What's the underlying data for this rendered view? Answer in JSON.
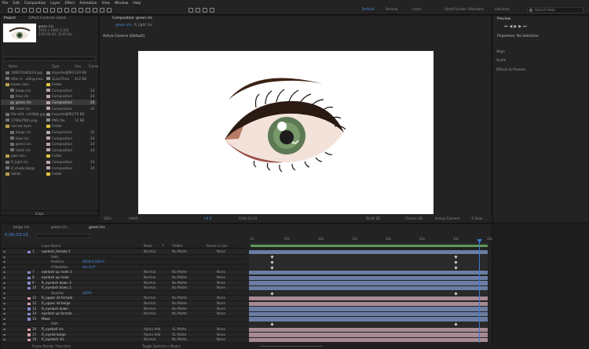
{
  "menu": [
    "File",
    "Edit",
    "Composition",
    "Layer",
    "Effect",
    "Animation",
    "View",
    "Window",
    "Help"
  ],
  "workspaces": [
    {
      "label": "Default",
      "active": true
    },
    {
      "label": "Review",
      "active": false
    },
    {
      "label": "Learn",
      "active": false
    },
    {
      "label": "Small Screen",
      "active": false
    },
    {
      "label": "Standard",
      "active": false
    },
    {
      "label": "Libraries",
      "active": false
    }
  ],
  "search_placeholder": "Search Help",
  "project": {
    "tab_project": "Project",
    "tab_effect": "Effect Controls: blank",
    "thumb_info": [
      "green iris",
      "1920 x 1080 (1.00)",
      "0:00:00:00, 24.00 fps"
    ],
    "columns": {
      "name": "Name",
      "type": "Type",
      "size": "Size",
      "frame": "Frame"
    },
    "items": [
      {
        "name": "1066703b5b19.jpg",
        "type": "ImportedJPEG",
        "size": "129 KB",
        "frame": "",
        "color": "#8a8a8a",
        "indent": 0,
        "sel": false
      },
      {
        "name": "Alter Ic...ading.mov",
        "type": "QuickTime",
        "size": "412 KB",
        "frame": "",
        "color": "#8a8a8a",
        "indent": 0,
        "sel": false
      },
      {
        "name": "brown skin",
        "type": "Folder",
        "size": "",
        "frame": "",
        "color": "#e0c040",
        "indent": 0,
        "sel": false
      },
      {
        "name": "beige iris",
        "type": "Composition",
        "size": "",
        "frame": "24",
        "color": "#b9a6a8",
        "indent": 1,
        "sel": false
      },
      {
        "name": "blue iris",
        "type": "Composition",
        "size": "",
        "frame": "24",
        "color": "#b9a6a8",
        "indent": 1,
        "sel": false
      },
      {
        "name": "green iris",
        "type": "Composition",
        "size": "",
        "frame": "24",
        "color": "#b9a6a8",
        "indent": 1,
        "sel": true
      },
      {
        "name": "hazel iris",
        "type": "Composition",
        "size": "",
        "frame": "24",
        "color": "#b9a6a8",
        "indent": 1,
        "sel": false
      },
      {
        "name": "file-ref4...ktzi0bb.jpg",
        "type": "ImportedJPEG",
        "size": "70 KB",
        "frame": "",
        "color": "#8a8a8a",
        "indent": 0,
        "sel": false
      },
      {
        "name": "1760a790h.png",
        "type": "PNG file",
        "size": "12 KB",
        "frame": "",
        "color": "#8a8a8a",
        "indent": 0,
        "sel": false
      },
      {
        "name": "narrow eyes",
        "type": "Folder",
        "size": "",
        "frame": "",
        "color": "#e0c040",
        "indent": 0,
        "sel": false
      },
      {
        "name": "beige iris",
        "type": "Composition",
        "size": "",
        "frame": "24",
        "color": "#b9a6a8",
        "indent": 1,
        "sel": false
      },
      {
        "name": "blue iris",
        "type": "Composition",
        "size": "",
        "frame": "24",
        "color": "#b9a6a8",
        "indent": 1,
        "sel": false
      },
      {
        "name": "green iris",
        "type": "Composition",
        "size": "",
        "frame": "24",
        "color": "#b9a6a8",
        "indent": 1,
        "sel": false
      },
      {
        "name": "hazel iris",
        "type": "Composition",
        "size": "",
        "frame": "24",
        "color": "#b9a6a8",
        "indent": 1,
        "sel": false
      },
      {
        "name": "pale skin",
        "type": "Folder",
        "size": "",
        "frame": "",
        "color": "#e0c040",
        "indent": 0,
        "sel": false
      },
      {
        "name": "R_light iris",
        "type": "Composition",
        "size": "",
        "frame": "24",
        "color": "#b9a6a8",
        "indent": 0,
        "sel": false
      },
      {
        "name": "R_shade beige",
        "type": "Composition",
        "size": "",
        "frame": "24",
        "color": "#b9a6a8",
        "indent": 0,
        "sel": false
      },
      {
        "name": "Solids",
        "type": "Folder",
        "size": "",
        "frame": "",
        "color": "#e0c040",
        "indent": 0,
        "sel": false
      }
    ],
    "footer_bpc": "8 bpc"
  },
  "composition": {
    "tab_label": "Composition: green iris",
    "sub_tabs": [
      "green iris",
      "R_light iris"
    ],
    "camera_label": "Active Camera (Default)",
    "zoom": "50%",
    "resolution": "(Half)",
    "timecode": "0:00:33:15",
    "draft": "Draft 3D",
    "renderer": "Classic 3D",
    "camera_select": "Active Camera",
    "views": "1 View",
    "offset": "+0.0"
  },
  "right_panel": {
    "preview": "Preview",
    "properties": "Properties: No Selection",
    "sections": [
      "Align",
      "Audio",
      "Effects & Presets"
    ]
  },
  "timeline": {
    "tabs": [
      {
        "label": "beige iris",
        "active": false
      },
      {
        "label": "green iris",
        "active": false
      },
      {
        "label": "green iris",
        "active": true
      }
    ],
    "timecode": "0:00:33:15",
    "columns": {
      "layer": "Layer Name",
      "mode": "Mode",
      "t": "T",
      "trkmat": "TrkMat",
      "parent": "Parent & Link"
    },
    "ruler": [
      "0s",
      "05s",
      "10s",
      "15s",
      "20s",
      "25s",
      "30s",
      "35s"
    ],
    "layers": [
      {
        "num": "1",
        "name": "eyelash_female 2",
        "mode": "Normal",
        "trkmat": "No Matte",
        "parent": "None",
        "color": "#8a8ad0",
        "bar": "#6b7da3",
        "kind": "layer"
      },
      {
        "num": "",
        "name": "Path",
        "mode": "",
        "trkmat": "",
        "parent": "",
        "color": "",
        "bar": "",
        "kind": "prop"
      },
      {
        "num": "",
        "name": "Position",
        "mode": "9650.0,508.0",
        "trkmat": "",
        "parent": "",
        "color": "",
        "bar": "",
        "kind": "prop"
      },
      {
        "num": "",
        "name": "X Rotation",
        "mode": "0x+0.0°",
        "trkmat": "",
        "parent": "",
        "color": "",
        "bar": "",
        "kind": "prop"
      },
      {
        "num": "7",
        "name": "eyelash up male 3",
        "mode": "Normal",
        "trkmat": "No Matte",
        "parent": "None",
        "color": "#8a8ad0",
        "bar": "#6b7da3",
        "kind": "layer"
      },
      {
        "num": "8",
        "name": "eyelash up male",
        "mode": "Normal",
        "trkmat": "No Matte",
        "parent": "None",
        "color": "#8a8ad0",
        "bar": "#6b7da3",
        "kind": "layer"
      },
      {
        "num": "9",
        "name": "R_eyelash down 3",
        "mode": "Normal",
        "trkmat": "No Matte",
        "parent": "None",
        "color": "#8a8ad0",
        "bar": "#6b7da3",
        "kind": "layer"
      },
      {
        "num": "10",
        "name": "R_eyelash down 2",
        "mode": "Normal",
        "trkmat": "No Matte",
        "parent": "None",
        "color": "#8a8ad0",
        "bar": "#6b7da3",
        "kind": "layer"
      },
      {
        "num": "",
        "name": "Opacity",
        "mode": "100%",
        "trkmat": "",
        "parent": "",
        "color": "",
        "bar": "",
        "kind": "prop"
      },
      {
        "num": "11",
        "name": "R_upper lid female",
        "mode": "Normal",
        "trkmat": "No Matte",
        "parent": "None",
        "color": "#d99aa6",
        "bar": "#a88a94",
        "kind": "layer"
      },
      {
        "num": "12",
        "name": "R_upper lid beige",
        "mode": "Normal",
        "trkmat": "No Matte",
        "parent": "None",
        "color": "#d99aa6",
        "bar": "#a88a94",
        "kind": "layer"
      },
      {
        "num": "13",
        "name": "R_eyelash down",
        "mode": "Normal",
        "trkmat": "No Matte",
        "parent": "None",
        "color": "#8a8ad0",
        "bar": "#6b7da3",
        "kind": "layer"
      },
      {
        "num": "14",
        "name": "eyelash up female",
        "mode": "Normal",
        "trkmat": "No Matte",
        "parent": "None",
        "color": "#8a8ad0",
        "bar": "#6b7da3",
        "kind": "layer"
      },
      {
        "num": "15",
        "name": "Mask",
        "mode": "",
        "trkmat": "",
        "parent": "",
        "color": "#8a8ad0",
        "bar": "#6b7da3",
        "kind": "layer"
      },
      {
        "num": "",
        "name": "Path",
        "mode": "",
        "trkmat": "",
        "parent": "",
        "color": "",
        "bar": "",
        "kind": "prop"
      },
      {
        "num": "16",
        "name": "R_eyeball iris",
        "mode": "Alpha Add",
        "trkmat": "SL Matte",
        "parent": "None",
        "color": "#d99aa6",
        "bar": "#a88a94",
        "kind": "layer"
      },
      {
        "num": "17",
        "name": "R_eyelid beige",
        "mode": "Alpha Add",
        "trkmat": "SL Matte",
        "parent": "None",
        "color": "#d99aa6",
        "bar": "#a88a94",
        "kind": "layer"
      },
      {
        "num": "18",
        "name": "R_eyelash iris",
        "mode": "Normal",
        "trkmat": "No Matte",
        "parent": "None",
        "color": "#d99aa6",
        "bar": "#a88a94",
        "kind": "layer"
      }
    ],
    "footer": "Frame Render Time  0ms",
    "toggle": "Toggle Switches / Modes"
  },
  "colors": {
    "accent": "#4c8fe0",
    "playhead": "#3a7bd5",
    "label_purple": "#8a8ad0",
    "label_pink": "#d99aa6",
    "work_area": "#5c9a5c"
  }
}
